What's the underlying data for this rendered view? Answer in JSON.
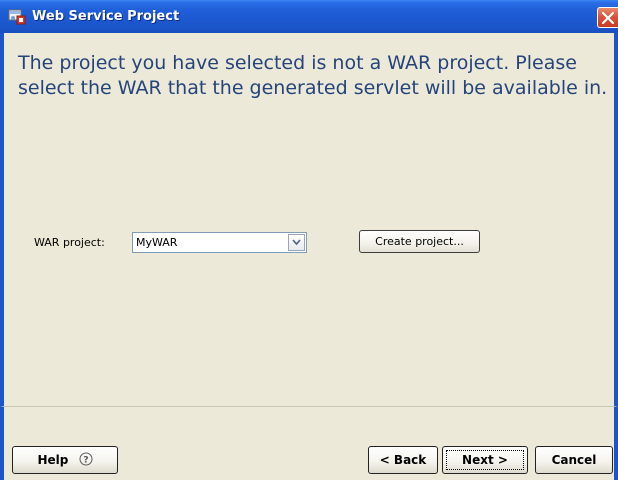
{
  "window": {
    "title": "Web Service Project",
    "icon": "web-service-project-icon",
    "close_icon": "close-icon",
    "colors": {
      "titlebar": "#1f5fd9",
      "frame": "#1b55c9",
      "panel": "#ece9d8",
      "message_text": "#25447b",
      "close_button": "#d8543a"
    }
  },
  "content": {
    "message": "The project you have selected is not a WAR project. Please select the WAR that the generated servlet will be available in.",
    "war_project": {
      "label": "WAR project:",
      "selected_value": "MyWAR",
      "dropdown_icon": "chevron-down-icon"
    },
    "create_project_label": "Create project..."
  },
  "buttons": {
    "help_label": "Help",
    "help_icon": "question-circle-icon",
    "back_label": "< Back",
    "next_label": "Next >",
    "cancel_label": "Cancel"
  }
}
